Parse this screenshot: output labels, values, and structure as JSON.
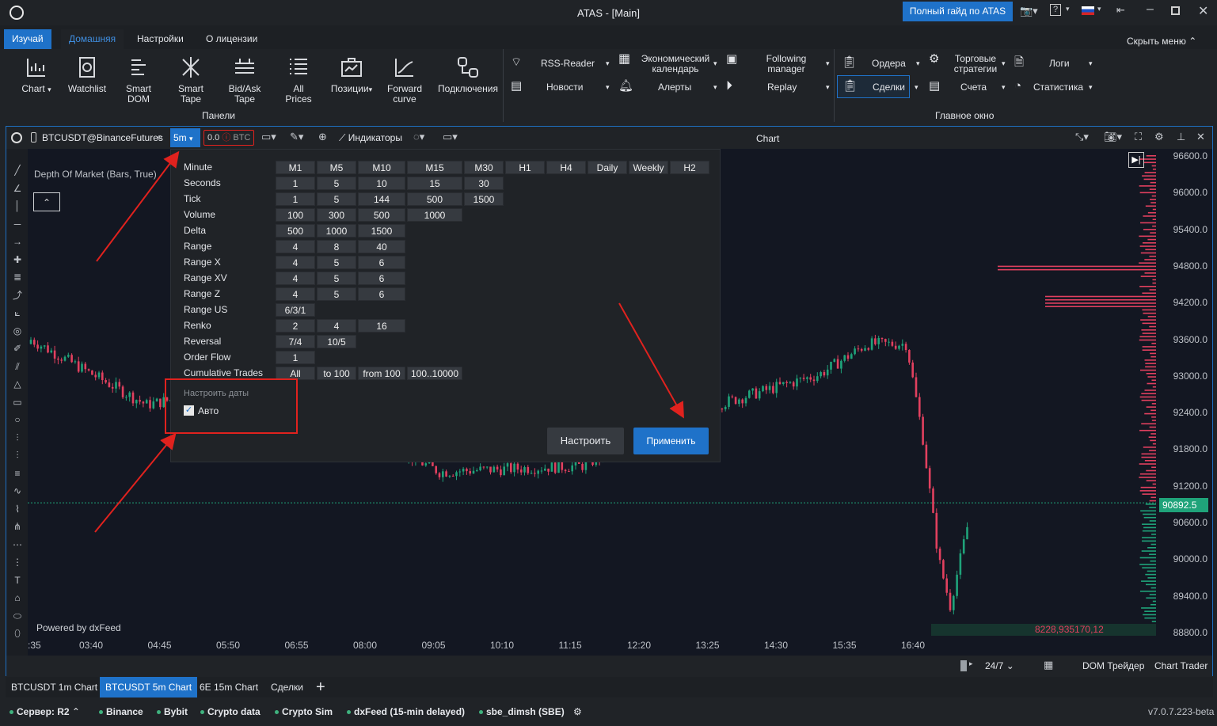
{
  "app": {
    "title": "ATAS - [Main]",
    "guide_button": "Полный гайд по ATAS",
    "version": "v7.0.7.223-beta"
  },
  "ribbon_tabs": [
    "Изучай",
    "Домашняя",
    "Настройки",
    "О лицензии"
  ],
  "hide_menu": "Скрыть меню",
  "ribbon": {
    "big": [
      "Chart",
      "Watchlist",
      "Smart DOM",
      "Smart Tape",
      "Bid/Ask Tape",
      "All Prices",
      "Позиции",
      "Forward curve",
      "Подключения"
    ],
    "panels_label": "Панели",
    "news_group": {
      "rss": "RSS-Reader",
      "news": "Новости",
      "econ": "Экономический календарь",
      "alerts": "Алерты",
      "following": "Following manager",
      "replay": "Replay"
    },
    "main_window": {
      "orders": "Ордера",
      "deals": "Сделки",
      "strategies": "Торговые стратегии",
      "accounts": "Счета",
      "logs": "Логи",
      "stats": "Статистика",
      "label": "Главное окно"
    }
  },
  "chart": {
    "symbol": "BTCUSDT@BinanceFutures",
    "timeframe": "5m",
    "volume_input": "0.0",
    "volume_unit": "BTC",
    "indicators": "Индикаторы",
    "window_title": "Chart",
    "indicator_label": "Depth Of Market (Bars, True)",
    "powered": "Powered by dxFeed",
    "last_price": "90892.5",
    "dom_values": "8228,935170,12",
    "price_ticks": [
      "96600.0",
      "96000.0",
      "95400.0",
      "94800.0",
      "94200.0",
      "93600.0",
      "93000.0",
      "92400.0",
      "91800.0",
      "91200.0",
      "90600.0",
      "90000.0",
      "89400.0",
      "88800.0"
    ],
    "time_ticks": [
      ":35",
      "03:40",
      "04:45",
      "05:50",
      "06:55",
      "08:00",
      "09:05",
      "10:10",
      "11:15",
      "12:20",
      "13:25",
      "14:30",
      "15:35",
      "16:40"
    ],
    "footer": {
      "session": "24/7",
      "dom_trader": "DOM Трейдер",
      "chart_trader": "Chart Trader"
    }
  },
  "popup": {
    "tooltip": "M5",
    "header": [
      "M1",
      "M5",
      "M10",
      "M15",
      "M30",
      "H1",
      "H4",
      "Daily",
      "Weekly",
      "H2"
    ],
    "rows": [
      {
        "label": "Minute",
        "values": []
      },
      {
        "label": "Seconds",
        "values": [
          "1",
          "5",
          "10",
          "15",
          "30"
        ]
      },
      {
        "label": "Tick",
        "values": [
          "1",
          "5",
          "144",
          "500",
          "1500"
        ]
      },
      {
        "label": "Volume",
        "values": [
          "100",
          "300",
          "500",
          "1000"
        ]
      },
      {
        "label": "Delta",
        "values": [
          "500",
          "1000",
          "1500"
        ]
      },
      {
        "label": "Range",
        "values": [
          "4",
          "8",
          "40"
        ]
      },
      {
        "label": "Range X",
        "values": [
          "4",
          "5",
          "6"
        ]
      },
      {
        "label": "Range XV",
        "values": [
          "4",
          "5",
          "6"
        ]
      },
      {
        "label": "Range Z",
        "values": [
          "4",
          "5",
          "6"
        ]
      },
      {
        "label": "Range US",
        "values": [
          "6/3/1"
        ]
      },
      {
        "label": "Renko",
        "values": [
          "2",
          "4",
          "16"
        ]
      },
      {
        "label": "Reversal",
        "values": [
          "7/4",
          "10/5"
        ]
      },
      {
        "label": "Order Flow",
        "values": [
          "1"
        ]
      },
      {
        "label": "Cumulative Trades",
        "values": [
          "All",
          "to 100",
          "from 100",
          "100..10000"
        ]
      }
    ],
    "dates_title": "Настроить даты",
    "auto_label": "Авто",
    "auto_checked": true,
    "configure_button": "Настроить",
    "apply_button": "Применить"
  },
  "bottom_tabs": [
    "BTCUSDT 1m Chart",
    "BTCUSDT 5m Chart",
    "6E 15m Chart",
    "Сделки"
  ],
  "status": {
    "server": "Сервер: R2",
    "connections": [
      "Binance",
      "Bybit",
      "Crypto data",
      "Crypto Sim",
      "dxFeed (15-min delayed)",
      "sbe_dimsh (SBE)"
    ]
  },
  "colors": {
    "accent": "#1e6fc1",
    "up": "#1fa37a",
    "down": "#e2405f",
    "annotation": "#e0221e"
  }
}
